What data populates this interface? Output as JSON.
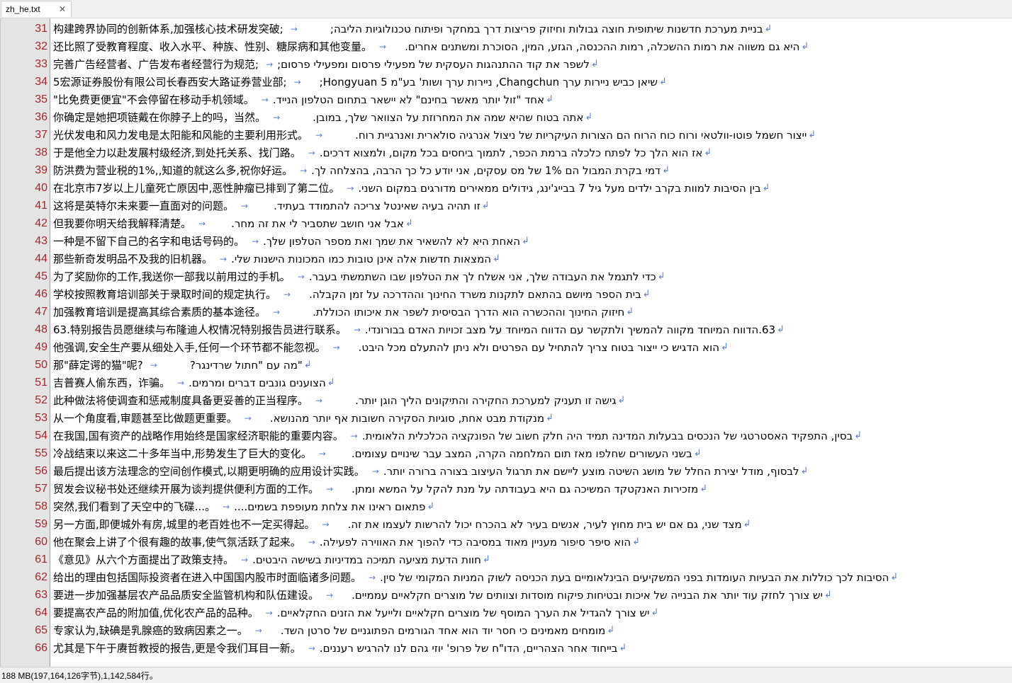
{
  "tab": {
    "filename": "zh_he.txt",
    "close_glyph": "✕"
  },
  "glyphs": {
    "tab_arrow": "→",
    "eol": "↲"
  },
  "lines": [
    {
      "n": "31",
      "zh": "构建跨界协同的创新体系,加强核心技术研发突破;",
      "he": "בניית מערכת חדשנות שיתופית חוצה גבולות וחיזוק פריצות דרך במחקר ופיתוח טכנולוגיות הליבה;",
      "gap": 40
    },
    {
      "n": "32",
      "zh": "还比照了受教育程度、收入水平、种族、性别、糖尿病和其他变量。",
      "he": "היא גם משווה את רמות ההשכלה, רמות ההכנסה, הגזע, המין, הסוכרת ומשתנים אחרים.",
      "gap": 20
    },
    {
      "n": "33",
      "zh": "完善广告经营者、广告发布者经营行为规范;",
      "he": "לשפר את קוד ההתנהגות העסקית של מפעילי פרסום ומפעילי פרסום;",
      "gap": 0
    },
    {
      "n": "34",
      "zh": "5宏源证券股份有限公司长春西安大路证券营业部;",
      "he": "שיאן כביש ניירות ערך Changchun, ניירות ערך ושות' בע\"מ Hongyuan 5;",
      "gap": 20
    },
    {
      "n": "35",
      "zh": "\"比免费更便宜\"不会停留在移动手机领域。",
      "he": "אחד \"זול יותר מאשר בחינם\" לא יישאר בתחום הטלפון הנייד.",
      "gap": 0
    },
    {
      "n": "36",
      "zh": "你确定是她把项链戴在你脖子上的吗，当然。",
      "he": "אתה בטוח שהיא שמה את המחרוזת על הצוואר שלך, במובן.",
      "gap": 40
    },
    {
      "n": "37",
      "zh": "光伏发电和风力发电是太阳能和风能的主要利用形式。",
      "he": "ייצור חשמל פוטו-וולטאי ורוח כוח הרוח הם הצורות העיקריות של ניצול אנרגיה סולארית ואנרגיית רוח.",
      "gap": 40
    },
    {
      "n": "38",
      "zh": "于是他全力以赴发展村级经济,到处托关系、找门路。",
      "he": "אז הוא הלך כל לפתח כלכלה ברמת הכפר, לתמוך ביחסים בכל מקום, ולמצוא דרכים.",
      "gap": 0
    },
    {
      "n": "39",
      "zh": "防洪费为营业税的1%,,知道的就这么多,祝你好运。",
      "he": "דמי בקרת המבול הם 1% של מס עסקים, אני יודע כל כך הרבה, בהצלחה לך.",
      "gap": 0
    },
    {
      "n": "40",
      "zh": "在北京市7岁以上儿童死亡原因中,恶性肿瘤已排到了第二位。",
      "he": "בין הסיבות למוות בקרב ילדים מעל גיל 7 בבייג'ינג, גידולים ממאירים מדורגים במקום השני.",
      "gap": 0
    },
    {
      "n": "41",
      "zh": "这将是英特尔未来要一直面对的问题。",
      "he": "זו תהיה בעיה שאינטל צריכה להתמודד בעתיד.",
      "gap": 30
    },
    {
      "n": "42",
      "zh": "但我要你明天给我解释清楚。",
      "he": "אבל אני חושב שתסביר לי את זה מחר.",
      "gap": 30
    },
    {
      "n": "43",
      "zh": "一种是不留下自己的名字和电话号码的。",
      "he": "האחת היא לא להשאיר את שמך ואת מספר הטלפון שלך.",
      "gap": 0
    },
    {
      "n": "44",
      "zh": "那些新奇发明品不及我的旧机器。",
      "he": "המצאות חדשות אלה אינן טובות כמו המכונות הישנות שלי.",
      "gap": 0
    },
    {
      "n": "45",
      "zh": "为了奖励你的工作,我送你一部我以前用过的手机。",
      "he": "כדי לתגמל את העבודה שלך, אני אשלח לך את הטלפון שבו השתמשתי בעבר.",
      "gap": 0
    },
    {
      "n": "46",
      "zh": "学校按照教育培训部关于录取时间的规定执行。",
      "he": "בית הספר מיושם בהתאם לתקנות משרד החינוך וההדרכה על זמן הקבלה.",
      "gap": 20
    },
    {
      "n": "47",
      "zh": "加强教育培训是提高其综合素质的基本途径。",
      "he": "חיזוק החינוך וההכשרה הוא הדרך הבסיסית לשפר את איכותו הכוללת.",
      "gap": 40
    },
    {
      "n": "48",
      "zh": "63.特别报告员愿继续与布隆迪人权情况特别报告员进行联系。",
      "he": "63.הדווח המיוחד מקווה להמשיך ולתקשר עם הדווח המיוחד על מצב זכויות האדם בבורונדי.",
      "gap": 0
    },
    {
      "n": "49",
      "zh": "他强调,安全生产要从细处入手,任何一个环节都不能忽视。",
      "he": "הוא הדגיש כי ייצור בטוח צריך להתחיל עם הפרטים ולא ניתן להתעלם מכל היבט.",
      "gap": 20
    },
    {
      "n": "50",
      "zh": "那\"薛定谔的猫\"呢?",
      "he": "\"מה עם \"חתול שרדינגר?",
      "gap": 40
    },
    {
      "n": "51",
      "zh": "吉普赛人偷东西，诈骗。",
      "he": "הצוענים גונבים דברים ומרמים.",
      "gap": 0
    },
    {
      "n": "52",
      "zh": "此种做法将使调查和惩戒制度具备更妥善的正当程序。",
      "he": "גישה זו תעניק למערכת החקירה והתיקונים הליך הוגן יותר.",
      "gap": 40
    },
    {
      "n": "53",
      "zh": "从一个角度看,审题甚至比做题更重要。",
      "he": "מנקודת מבט אחת, סוגיות הסקירה חשובות אף יותר מהנושא.",
      "gap": 20
    },
    {
      "n": "54",
      "zh": "在我国,国有资产的战略作用始终是国家经济职能的重要内容。",
      "he": "בסין, התפקיד האסטרטגי של הנכסים בבעלות המדינה תמיד היה חלק חשוב של הפונקציה הכלכלית הלאומית.",
      "gap": 0
    },
    {
      "n": "55",
      "zh": "冷战结束以来这二十多年当中,形势发生了巨大的变化。",
      "he": "בשני העשורים שחלפו מאז תום המלחמה הקרה, המצב עבר שינויים עצומים.",
      "gap": 30
    },
    {
      "n": "56",
      "zh": "最后提出该方法理念的空间创作模式,以期更明确的应用设计实践。",
      "he": "לבסוף, מודל יצירת החלל של מושג השיטה מוצע ליישם את תרגול העיצוב בצורה ברורה יותר.",
      "gap": 0
    },
    {
      "n": "57",
      "zh": "贸发会议秘书处还继续开展为谈判提供便利方面的工作。",
      "he": "מזכירות האנקטקד המשיכה גם היא בעבודתה על מנת להקל על המשא ומתן.",
      "gap": 20
    },
    {
      "n": "58",
      "zh": "突然,我们看到了天空中的飞碟...。",
      "he": "פתאום ראינו את צלחת מעופפת בשמים....",
      "gap": 0
    },
    {
      "n": "59",
      "zh": "另一方面,即便城外有房,城里的老百姓也不一定买得起。",
      "he": "מצד שני, גם אם יש בית מחוץ לעיר, אנשים בעיר לא בהכרח יכול להרשות לעצמו את זה.",
      "gap": 20
    },
    {
      "n": "60",
      "zh": "他在聚会上讲了个很有趣的故事,使气氛活跃了起来。",
      "he": "הוא סיפר סיפור מעניין מאוד במסיבה כדי להפוך את האווירה לפעילה.",
      "gap": 0
    },
    {
      "n": "61",
      "zh": "《意见》从六个方面提出了政策支持。",
      "he": "חוות הדעת מציעה תמיכה במדיניות בשישה היבטים.",
      "gap": 0
    },
    {
      "n": "62",
      "zh": "给出的理由包括国际投资者在进入中国国内股市时面临诸多问题。",
      "he": "הסיבות לכך כוללות את הבעיות העומדות בפני המשקיעים הבינלאומיים בעת הכניסה לשוק המניות המקומי של סין.",
      "gap": 0
    },
    {
      "n": "63",
      "zh": "要进一步加强基层农产品品质安全监管机构和队伍建设。",
      "he": "יש צורך לחזק עוד יותר את הבנייה של איכות ובטיחות פיקוח מוסדות וצוותים של מוצרים חקלאיים עממיים.",
      "gap": 20
    },
    {
      "n": "64",
      "zh": "要提高农产品的附加值,优化农产品的品种。",
      "he": "יש צורך להגדיל את הערך המוסף של מוצרים חקלאיים ולייעל את הזנים החקלאיים.",
      "gap": 0
    },
    {
      "n": "65",
      "zh": "专家认为,缺碘是乳腺癌的致病因素之一。",
      "he": "מומחים מאמינים כי חסר יוד הוא אחד הגורמים הפתוגניים של סרטן השד.",
      "gap": 20
    },
    {
      "n": "66",
      "zh": "尤其是下午于赓哲教授的报告,更是令我们耳目一新。",
      "he": "בייחוד אחר הצהריים, הדו\"ח של פרופ' יוזי גהם לנו להרגיש רעננים.",
      "gap": 0
    }
  ],
  "status": {
    "text": "188 MB(197,164,126字节),1,142,584行。"
  }
}
